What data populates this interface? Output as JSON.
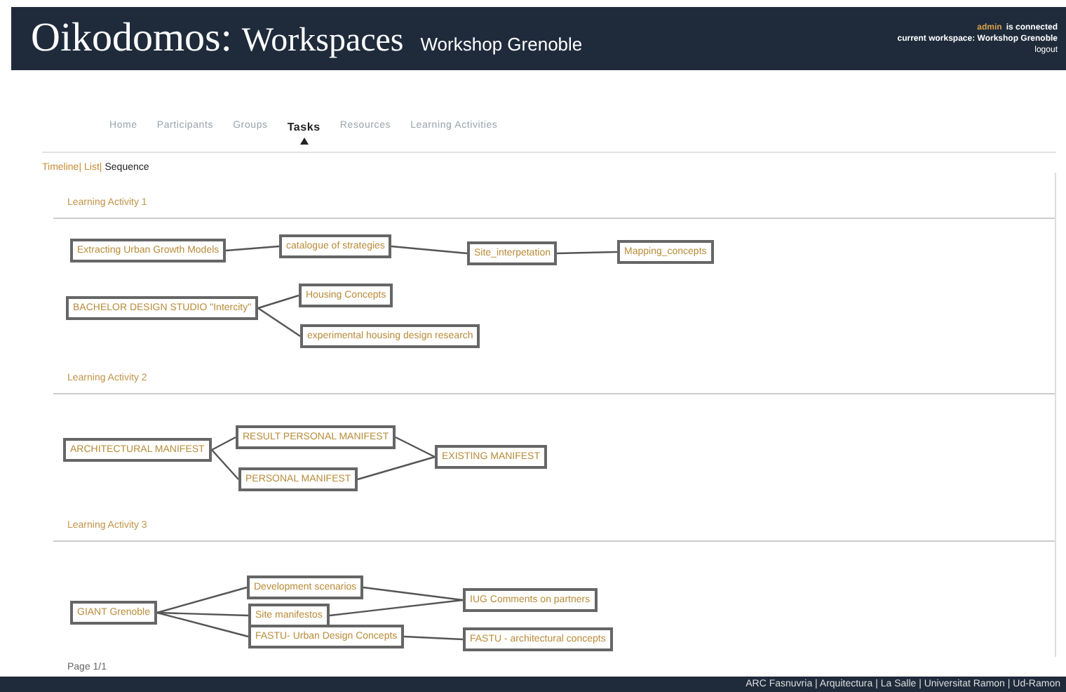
{
  "header": {
    "brand": "Oikodomos:",
    "product": "Workspaces",
    "workspace": "Workshop Grenoble",
    "user": "admin",
    "connected_text": "is connected",
    "current_workspace": "current workspace: Workshop Grenoble",
    "logout": "logout"
  },
  "tabs": [
    {
      "label": "Home",
      "selected": false
    },
    {
      "label": "Participants",
      "selected": false
    },
    {
      "label": "Groups",
      "selected": false
    },
    {
      "label": "Tasks",
      "selected": true
    },
    {
      "label": "Resources",
      "selected": false
    },
    {
      "label": "Learning Activities",
      "selected": false
    }
  ],
  "views": [
    {
      "label": "Timeline|",
      "selected": false
    },
    {
      "label": "List|",
      "selected": false
    },
    {
      "label": "Sequence",
      "selected": true
    }
  ],
  "activities": [
    {
      "title": "Learning Activity 1",
      "tasks": [
        "Extracting Urban Growth Models",
        "catalogue of strategies",
        "Site_interpetation",
        "Mapping_concepts",
        "BACHELOR DESIGN STUDIO \"Intercity\"",
        "Housing Concepts",
        "experimental housing design research"
      ]
    },
    {
      "title": "Learning Activity 2",
      "tasks": [
        "ARCHITECTURAL MANIFEST",
        "RESULT PERSONAL MANIFEST",
        "PERSONAL MANIFEST",
        "EXISTING MANIFEST"
      ]
    },
    {
      "title": "Learning Activity 3",
      "tasks": [
        "GIANT Grenoble",
        "Development scenarios",
        "Site manifestos",
        "FASTU- Urban Design Concepts",
        "IUG Comments on partners",
        "FASTU - architectural concepts"
      ]
    }
  ],
  "pager": "Page 1/1",
  "footer": "ARC Fasnuvria | Arquitectura | La Salle | Universitat Ramon | Ud-Ramon"
}
